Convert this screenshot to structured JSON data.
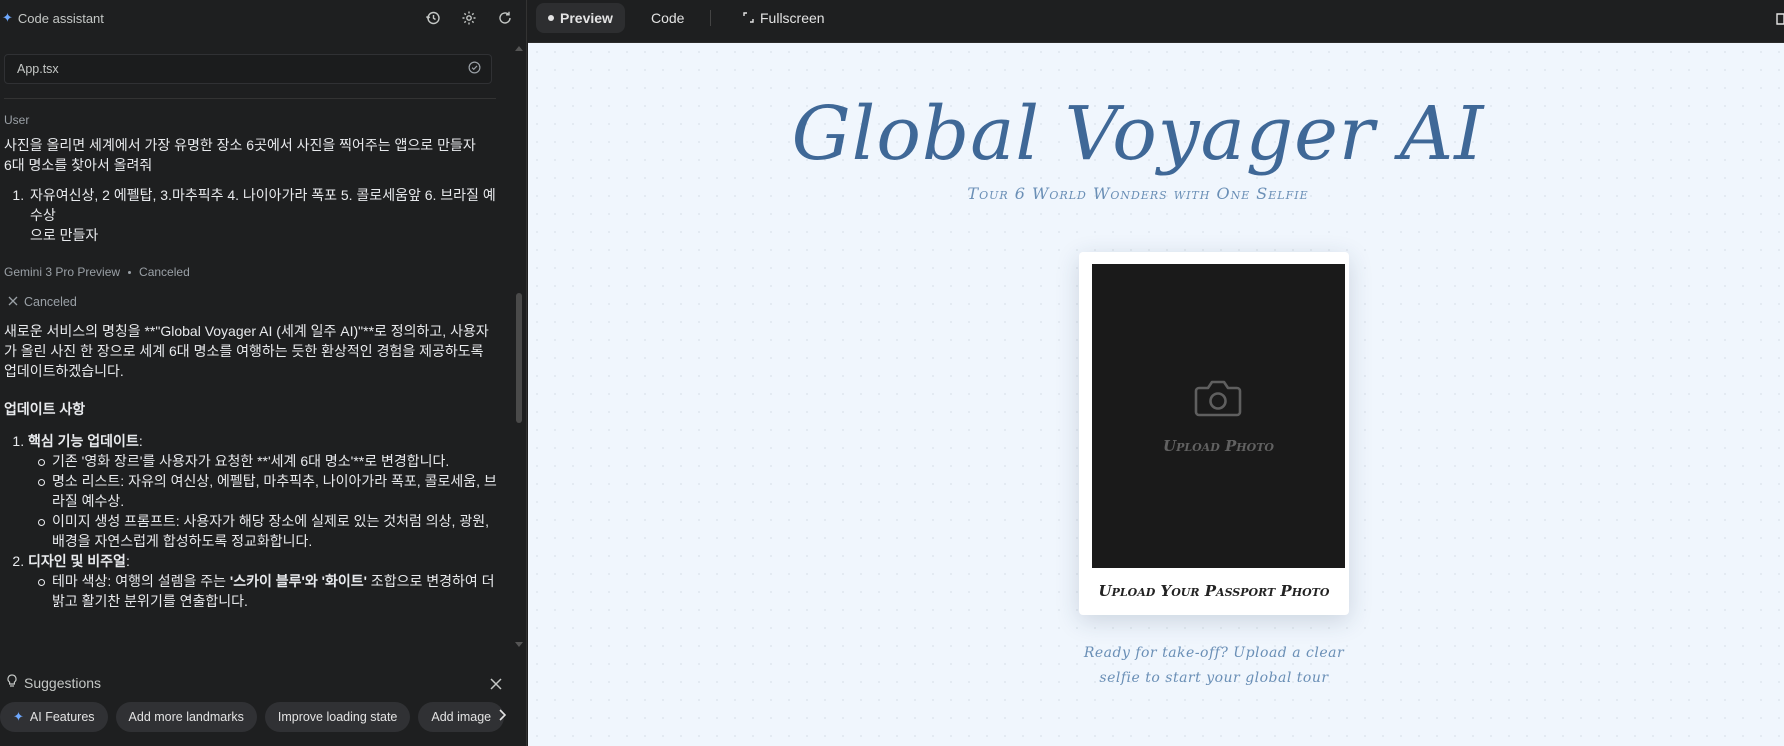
{
  "assistant": {
    "title": "Code assistant",
    "file": "App.tsx",
    "user_role": "User",
    "user_message_line1": "사진을 올리면 세계에서 가장 유명한 장소 6곳에서 사진을 찍어주는 앱으로 만들자",
    "user_message_line2": "6대 명소를 찾아서 올려줘",
    "user_list_item": "자유여신상, 2 에펠탑, 3.마추픽추 4. 나이아가라 폭포 5. 콜로세움앞 6. 브라질 예수상",
    "user_list_tail": "으로 만들자",
    "model_name": "Gemini 3 Pro Preview",
    "model_status": "Canceled",
    "canceled_label": "Canceled",
    "response_intro": "새로운 서비스의 명칭을 **\"Global Voyager AI (세계 일주 AI)\"**로 정의하고, 사용자가 올린 사진 한 장으로 세계 6대 명소를 여행하는 듯한 환상적인 경험을 제공하도록 업데이트하겠습니다.",
    "response_heading": "업데이트 사항",
    "section1_title": "핵심 기능 업데이트",
    "section1_bullets": [
      "기존 '영화 장르'를 사용자가 요청한 **'세계 6대 명소'**로 변경합니다.",
      "명소 리스트: 자유의 여신상, 에펠탑, 마추픽추, 나이아가라 폭포, 콜로세움, 브라질 예수상.",
      "이미지 생성 프롬프트: 사용자가 해당 장소에 실제로 있는 것처럼 의상, 광원, 배경을 자연스럽게 합성하도록 정교화합니다."
    ],
    "section2_title": "디자인 및 비주얼",
    "section2_bullet_prefix": "테마 색상: 여행의 설렘을 주는 ",
    "section2_bullet_bold": "'스카이 블루'와 '화이트'",
    "section2_bullet_suffix": " 조합으로 변경하여 더 밝고 활기찬 분위기를 연출합니다.",
    "suggestions_label": "Suggestions",
    "chips": [
      "AI Features",
      "Add more landmarks",
      "Improve loading state",
      "Add image"
    ]
  },
  "topbar": {
    "preview_tab": "Preview",
    "code_tab": "Code",
    "fullscreen": "Fullscreen"
  },
  "preview": {
    "title": "Global Voyager AI",
    "subtitle": "Tour 6 World Wonders with One Selfie",
    "upload_photo": "Upload Photo",
    "polaroid_caption": "Upload Your Passport Photo",
    "hint_line1": "Ready for take-off? Upload a clear",
    "hint_line2": "selfie to start your global tour"
  },
  "colors": {
    "accent": "#3f6897",
    "preview_bg": "#f0f6fd",
    "panel_bg": "#1e1f20"
  }
}
